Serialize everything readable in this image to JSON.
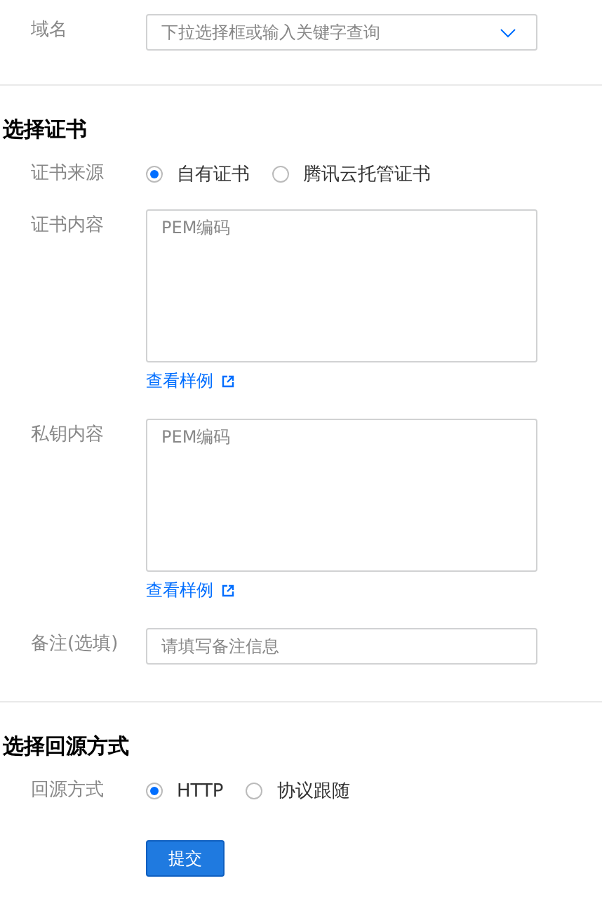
{
  "sections": [
    {
      "rows": [
        {
          "kind": "select",
          "label": "域名",
          "placeholder": "下拉选择框或输入关键字查询"
        }
      ]
    },
    {
      "title": "选择证书",
      "rows": [
        {
          "kind": "radio",
          "label": "证书来源",
          "options": [
            {
              "label": "自有证书",
              "selected": true
            },
            {
              "label": "腾讯云托管证书",
              "selected": false
            }
          ]
        },
        {
          "kind": "textarea",
          "label": "证书内容",
          "placeholder": "PEM编码",
          "link": "查看样例"
        },
        {
          "kind": "textarea",
          "label": "私钥内容",
          "placeholder": "PEM编码",
          "link": "查看样例"
        },
        {
          "kind": "input",
          "label": "备注(选填)",
          "placeholder": "请填写备注信息"
        }
      ]
    },
    {
      "title": "选择回源方式",
      "rows": [
        {
          "kind": "radio",
          "label": "回源方式",
          "options": [
            {
              "label": "HTTP",
              "selected": true
            },
            {
              "label": "协议跟随",
              "selected": false
            }
          ]
        },
        {
          "kind": "button",
          "text": "提交"
        }
      ]
    }
  ]
}
